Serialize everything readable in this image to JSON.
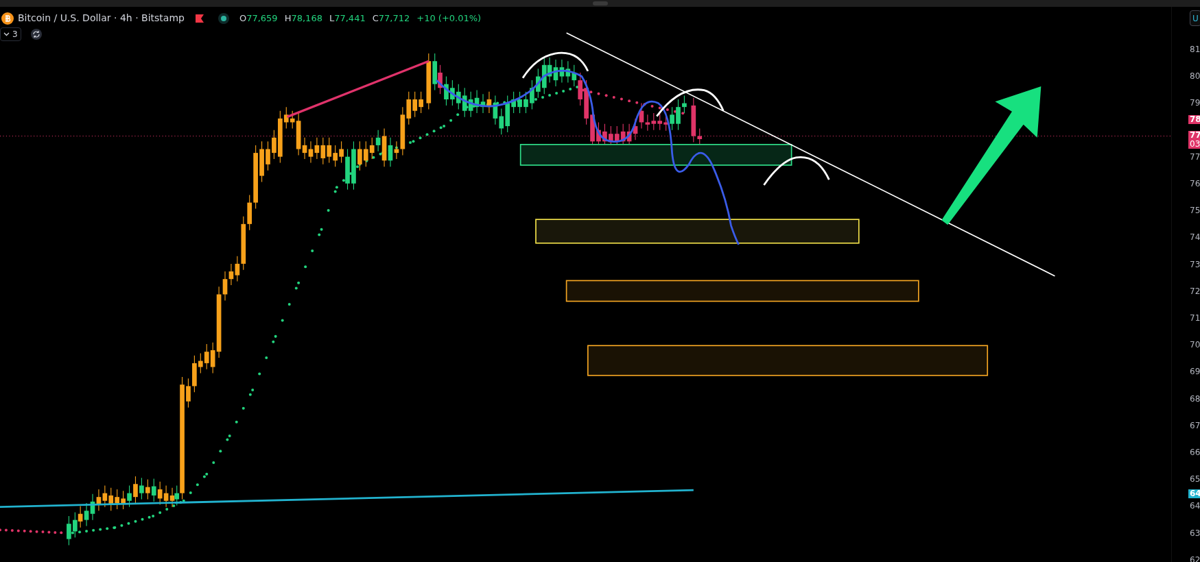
{
  "header": {
    "symbol": "Bitcoin / U.S. Dollar · 4h · Bitstamp",
    "ohlc": [
      {
        "label": "O",
        "value": "77,659"
      },
      {
        "label": "H",
        "value": "78,168"
      },
      {
        "label": "L",
        "value": "77,441"
      },
      {
        "label": "C",
        "value": "77,712"
      }
    ],
    "change": "+10 (+0.01%)"
  },
  "toolbar": {
    "indicators_count": "3"
  },
  "price_axis": {
    "currency": "U",
    "ticks": [
      "81",
      "80",
      "79",
      "77",
      "76",
      "75",
      "74",
      "73",
      "72",
      "71",
      "70",
      "69",
      "68",
      "67",
      "66",
      "65",
      "64",
      "63",
      "62"
    ],
    "badges": [
      {
        "lines": [
          "78"
        ],
        "color": "#e03468"
      },
      {
        "lines": [
          "77",
          "03"
        ],
        "color": "#e03468"
      },
      {
        "lines": [
          "64"
        ],
        "color": "#22b3cf"
      }
    ]
  }
}
